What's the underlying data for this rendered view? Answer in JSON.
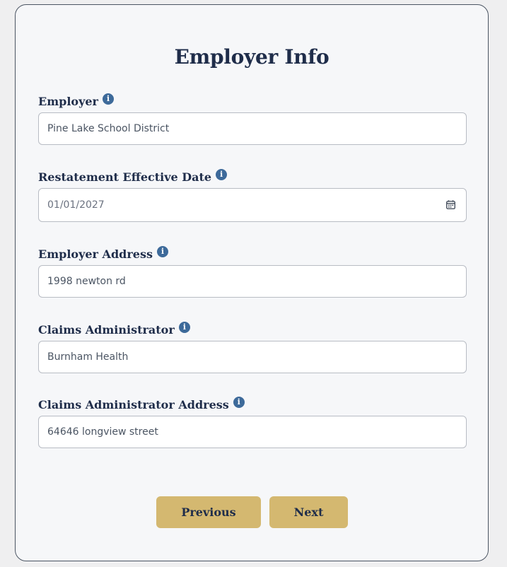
{
  "form": {
    "title": "Employer Info",
    "fields": [
      {
        "label": "Employer",
        "value": "Pine Lake School District"
      },
      {
        "label": "Restatement Effective Date",
        "value": "01/01/2027"
      },
      {
        "label": "Employer Address",
        "value": "1998 newton rd"
      },
      {
        "label": "Claims Administrator",
        "value": "Burnham Health"
      },
      {
        "label": "Claims Administrator Address",
        "value": "64646 longview street"
      }
    ],
    "info_glyph": "i"
  },
  "buttons": {
    "previous": "Previous",
    "next": "Next"
  },
  "colors": {
    "accent_button": "#d4b870",
    "heading": "#1f2d4a",
    "info_icon": "#3d6a9a",
    "card_background": "#f6f7f9"
  },
  "icons": [
    "info-icon",
    "calendar-icon"
  ]
}
